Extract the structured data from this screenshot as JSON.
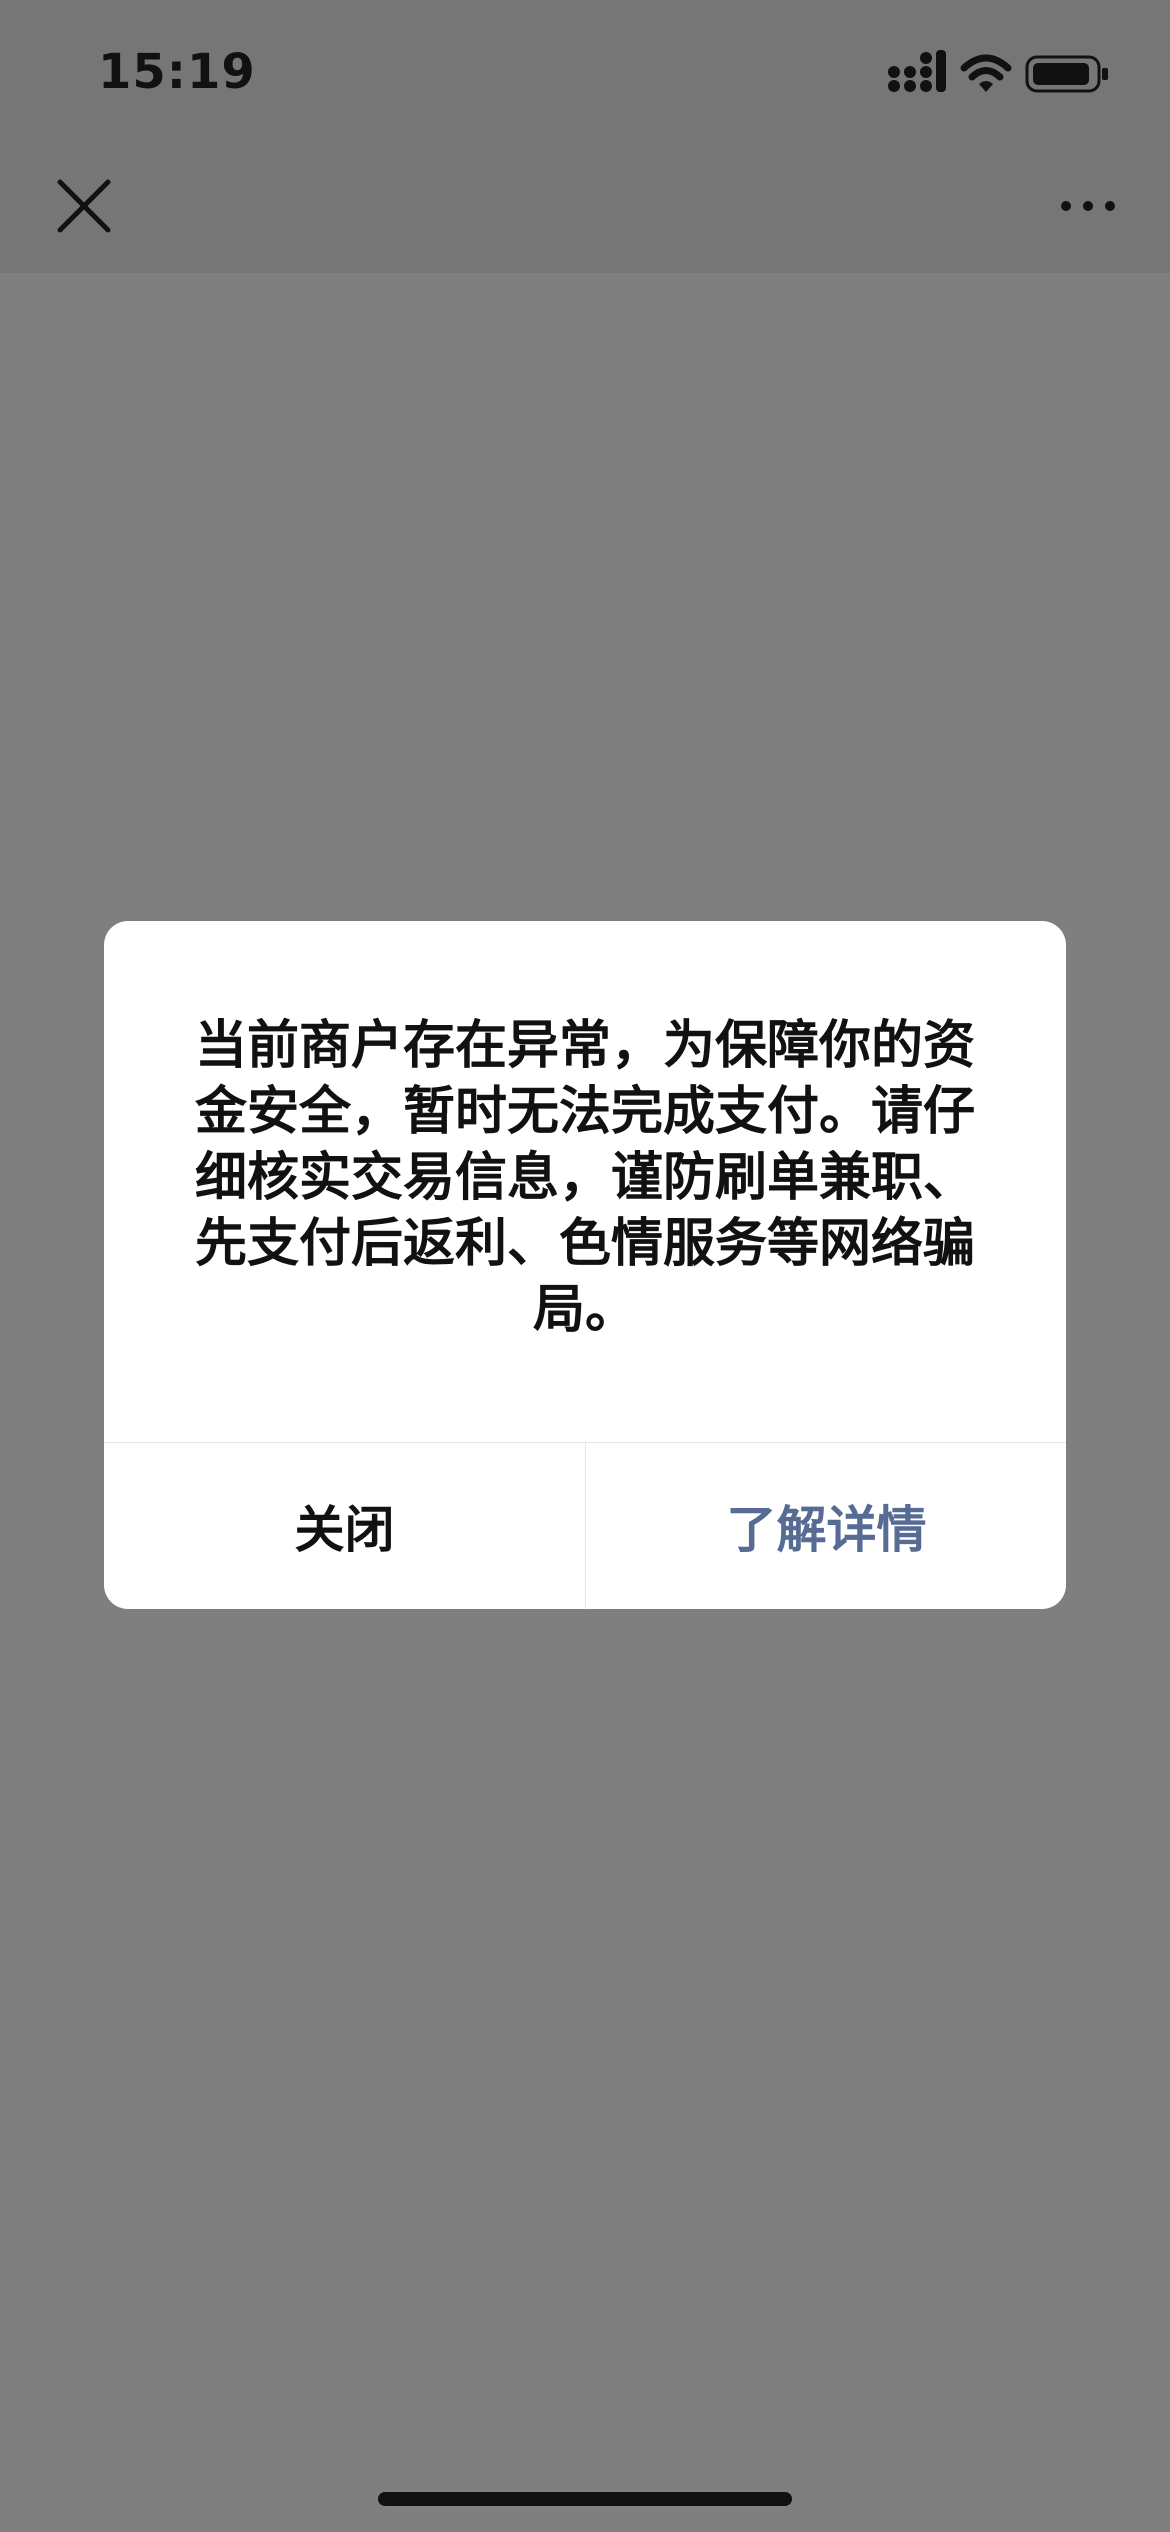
{
  "status_bar": {
    "time": "15:19",
    "signal_icon": "cellular-signal-icon",
    "wifi_icon": "wifi-icon",
    "battery_icon": "battery-icon"
  },
  "nav_bar": {
    "close_icon": "close-icon",
    "more_icon": "more-icon"
  },
  "dialog": {
    "message": "当前商户存在异常，为保障你的资金安全，暂时无法完成支付。请仔细核实交易信息，谨防刷单兼职、先支付后返利、色情服务等网络骗局。",
    "close_label": "关闭",
    "details_label": "了解详情"
  },
  "colors": {
    "background_overlay": "#7f7f7f",
    "link_color": "#576b95"
  }
}
